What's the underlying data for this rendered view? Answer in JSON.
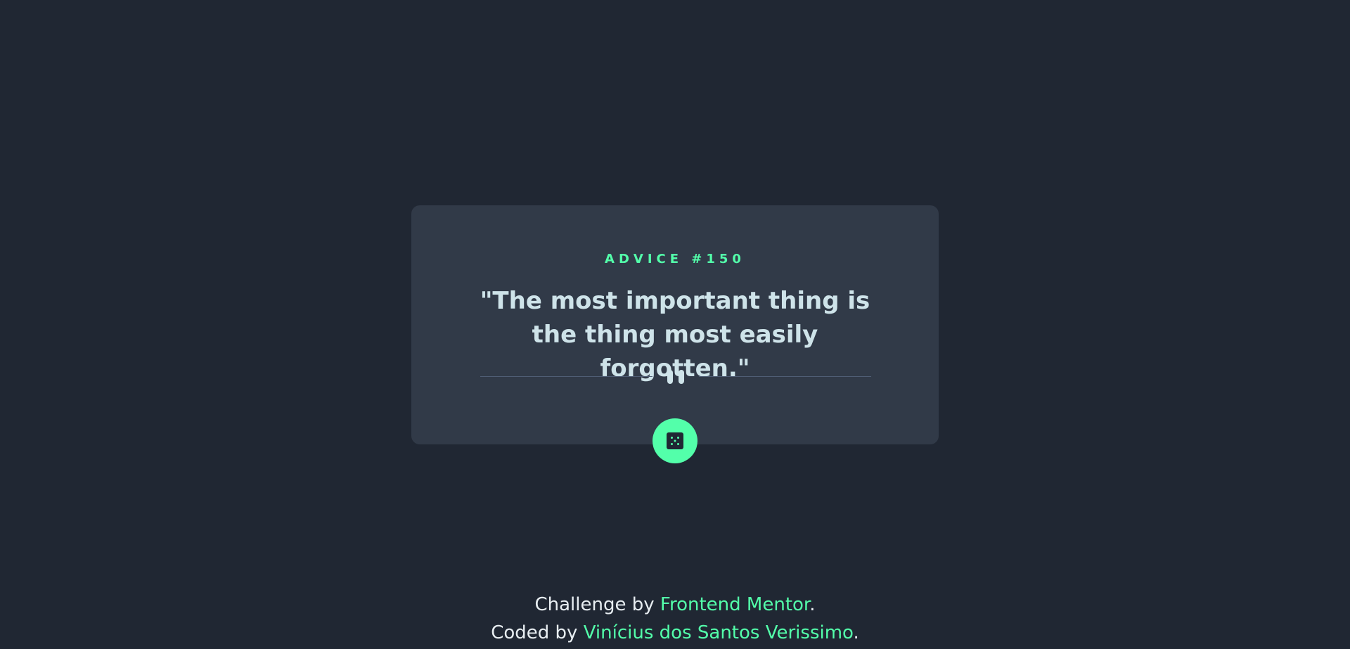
{
  "advice": {
    "number_label": "ADVICE #150",
    "quote": "\"The most important thing is the thing most easily forgotten.\""
  },
  "icons": {
    "divider": "pause-icon",
    "button": "dice-icon"
  },
  "footer": {
    "line1_prefix": "Challenge by ",
    "line1_link": "Frontend Mentor",
    "line1_suffix": ".",
    "line2_prefix": "Coded by ",
    "line2_link": "Vinícius dos Santos Verissimo",
    "line2_suffix": "."
  },
  "colors": {
    "background": "#202733",
    "card": "#313a48",
    "accent": "#53ffaa",
    "text": "#cee3e9",
    "divider": "#4f5d74"
  }
}
